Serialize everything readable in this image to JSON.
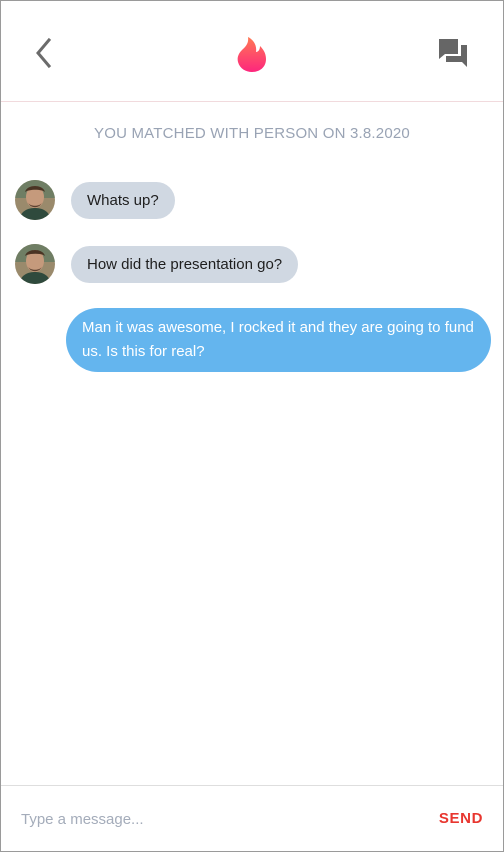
{
  "header": {
    "back_icon": "chevron-left-icon",
    "logo_icon": "flame-icon",
    "chat_icon": "chat-bubbles-icon"
  },
  "match_note": "YOU MATCHED WITH PERSON ON 3.8.2020",
  "messages": [
    {
      "from": "them",
      "text": "Whats up?"
    },
    {
      "from": "them",
      "text": "How did the presentation go?"
    },
    {
      "from": "me",
      "text": "Man it was awesome, I rocked it and they are going to fund us. Is this for real?"
    }
  ],
  "composer": {
    "placeholder": "Type a message...",
    "value": "",
    "send_label": "SEND"
  },
  "colors": {
    "incoming_bubble": "#d0d8e2",
    "outgoing_bubble": "#64b5ee",
    "send_accent": "#e8362f",
    "flame_top": "#ff7854",
    "flame_bottom": "#fd267d",
    "muted_text": "#99a3b4"
  }
}
